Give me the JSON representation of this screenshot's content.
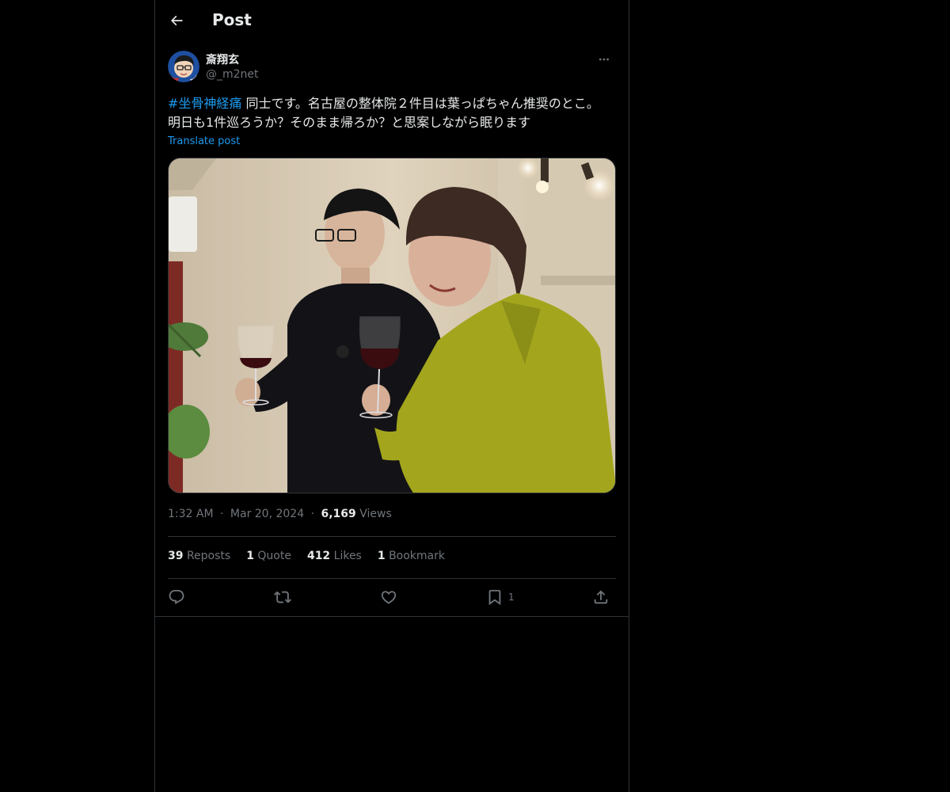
{
  "header": {
    "title": "Post"
  },
  "author": {
    "display_name": "斎翔玄",
    "handle": "@_m2net"
  },
  "post": {
    "hashtag": "#坐骨神経痛",
    "text": " 同士です。名古屋の整体院２件目は葉っぱちゃん推奨のとこ。明日も1件巡ろうか？そのまま帰ろか？と思案しながら眠ります",
    "translate_label": "Translate post"
  },
  "meta": {
    "time": "1:32 AM",
    "separator": "·",
    "date": "Mar 20, 2024",
    "views_count": "6,169",
    "views_label": "Views"
  },
  "stats": {
    "reposts_count": "39",
    "reposts_label": "Reposts",
    "quotes_count": "1",
    "quotes_label": "Quote",
    "likes_count": "412",
    "likes_label": "Likes",
    "bookmarks_count": "1",
    "bookmarks_label": "Bookmark"
  },
  "actions": {
    "bookmark_count": "1",
    "icons": [
      "reply-icon",
      "repost-icon",
      "like-icon",
      "bookmark-icon",
      "share-icon"
    ]
  },
  "colors": {
    "background": "#000000",
    "text": "#e7e9ea",
    "secondary": "#71767b",
    "accent": "#1d9bf0",
    "border": "#2f3336"
  }
}
